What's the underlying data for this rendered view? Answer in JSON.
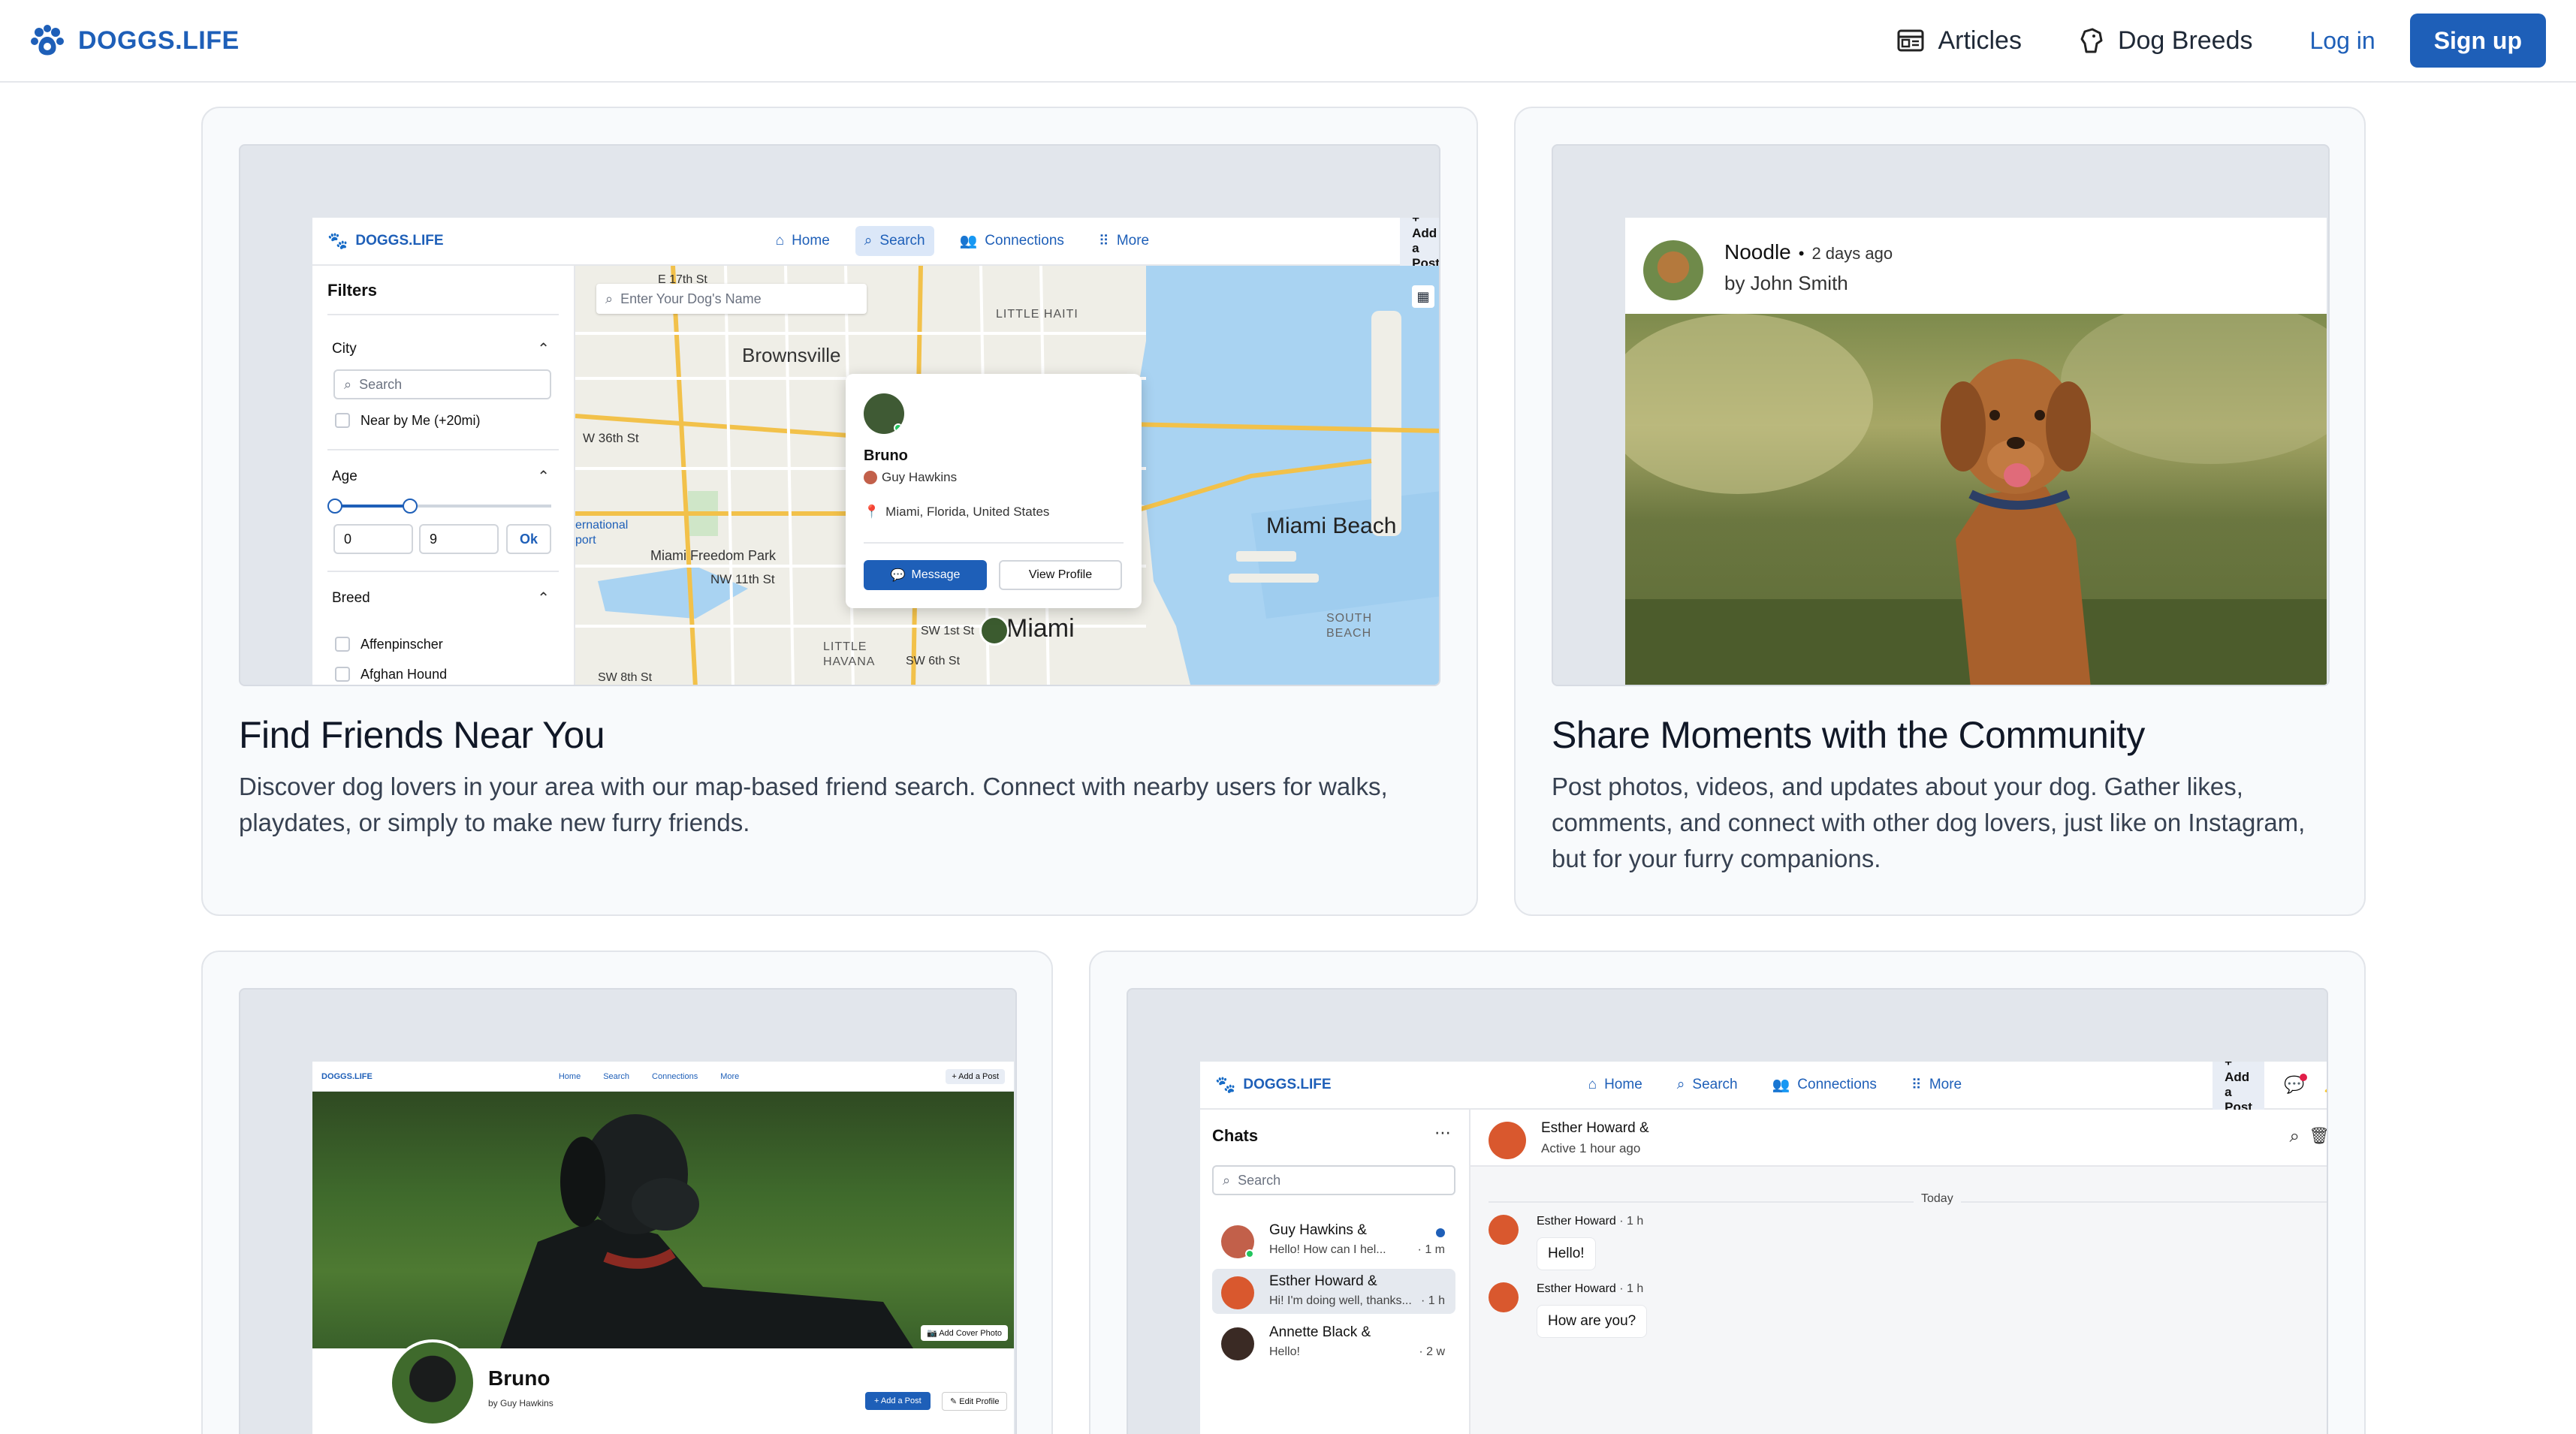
{
  "topnav": {
    "brand": "DOGGS.LIFE",
    "articles": "Articles",
    "dog_breeds": "Dog Breeds",
    "login": "Log in",
    "signup": "Sign up",
    "brand_color": "#1e5fb8"
  },
  "features": [
    {
      "title": "Find Friends Near You",
      "desc": "Discover dog lovers in your area with our map-based friend search. Connect with nearby users for walks, playdates, or simply to make new furry friends."
    },
    {
      "title": "Share Moments with the Community",
      "desc": "Post photos, videos, and updates about your dog. Gather likes, comments, and connect with other dog lovers, just like on Instagram, but for your furry companions."
    }
  ],
  "mini_app": {
    "brand": "DOGGS.LIFE",
    "nav": {
      "home": "Home",
      "search": "Search",
      "connections": "Connections",
      "more": "More"
    },
    "add_post": "+ Add a Post"
  },
  "search_shot": {
    "filters_title": "Filters",
    "city_label": "City",
    "city_placeholder": "Search",
    "near_me": "Near by Me (+20mi)",
    "age_label": "Age",
    "age_min": "0",
    "age_max": "9",
    "age_ok": "Ok",
    "breed_label": "Breed",
    "breeds": [
      "Affenpinscher",
      "Afghan Hound"
    ],
    "map_search_placeholder": "Enter Your Dog's Name",
    "map_labels": {
      "brownsville": "Brownsville",
      "miami_beach": "Miami Beach",
      "miami": "Miami",
      "freedom_park": "Miami Freedom Park",
      "e17": "E 17th St",
      "nw36": "W 36th St",
      "nw11": "NW 11th St",
      "sw8": "SW 8th St",
      "sw6": "SW 6th St",
      "sw1": "SW 1st St",
      "little_havana": "LITTLE\nHAVANA",
      "little_haiti": "LITTLE HAITI",
      "south_beach": "SOUTH\nBEACH",
      "intl_port": "ernational\nport"
    },
    "popup": {
      "dog_name": "Bruno",
      "owner": "Guy Hawkins",
      "location": "Miami, Florida, United States",
      "message": "Message",
      "view_profile": "View Profile"
    }
  },
  "feed_shot": {
    "dog_name": "Noodle",
    "time": "2 days ago",
    "author": "by John Smith"
  },
  "profile_shot": {
    "dog_name": "Bruno",
    "owner": "by Guy Hawkins",
    "add_cover": "Add Cover Photo",
    "add_post": "+ Add a Post",
    "edit_profile": "Edit Profile"
  },
  "chat_shot": {
    "chats_title": "Chats",
    "search_placeholder": "Search",
    "header_name": "Esther Howard &",
    "header_status": "Active 1 hour ago",
    "today": "Today",
    "chats": [
      {
        "name": "Guy Hawkins &",
        "msg": "Hello! How can I hel...",
        "time": "· 1 m"
      },
      {
        "name": "Esther Howard &",
        "msg": "Hi! I'm doing well, thanks...",
        "time": "· 1 h"
      },
      {
        "name": "Annette Black &",
        "msg": "Hello!",
        "time": "· 2 w"
      }
    ],
    "messages": [
      {
        "author": "Esther Howard",
        "time": "· 1 h",
        "text": "Hello!"
      },
      {
        "author": "Esther Howard",
        "time": "· 1 h",
        "text": "How are you?"
      }
    ]
  }
}
